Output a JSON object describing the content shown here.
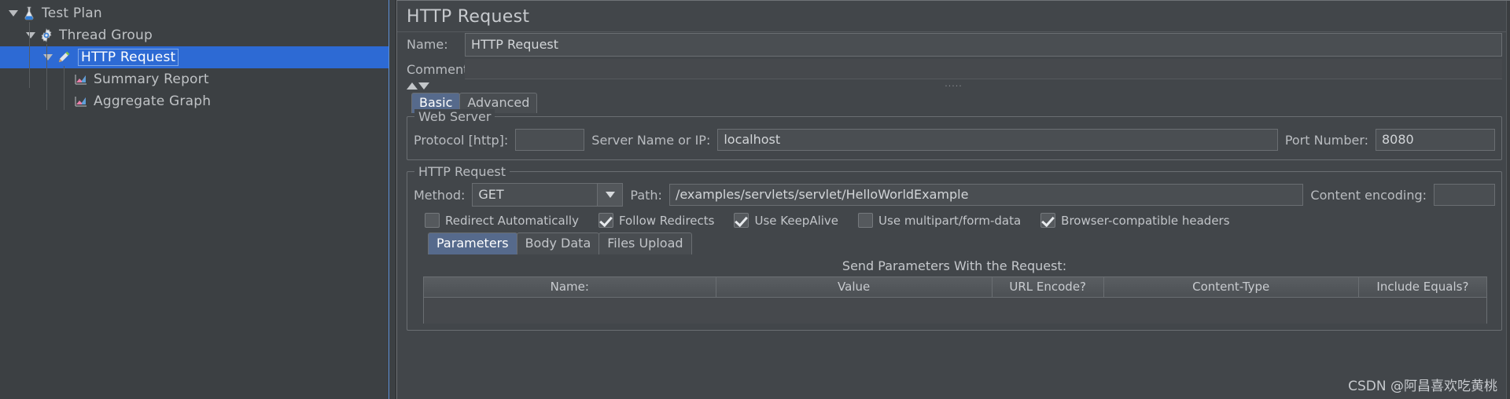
{
  "tree": {
    "items": [
      {
        "label": "Test Plan",
        "icon": "flask-icon",
        "indent": 1,
        "expanded": true,
        "selected": false
      },
      {
        "label": "Thread Group",
        "icon": "gear-icon",
        "indent": 2,
        "expanded": true,
        "selected": false
      },
      {
        "label": "HTTP Request",
        "icon": "pencil-icon",
        "indent": 3,
        "expanded": true,
        "selected": true
      },
      {
        "label": "Summary Report",
        "icon": "chart-icon",
        "indent": 4,
        "expanded": false,
        "selected": false
      },
      {
        "label": "Aggregate Graph",
        "icon": "chart-icon",
        "indent": 4,
        "expanded": false,
        "selected": false
      }
    ]
  },
  "detail": {
    "title": "HTTP Request",
    "name_label": "Name:",
    "name_value": "HTTP Request",
    "comments_label": "Comments:",
    "comments_value": "",
    "collapse_up_icon": "triangle-up-icon",
    "collapse_down_icon": "triangle-down-icon",
    "grip_glyph": "·····",
    "tabs": [
      {
        "label": "Basic",
        "active": true
      },
      {
        "label": "Advanced",
        "active": false
      }
    ],
    "web_server": {
      "group_label": "Web Server",
      "protocol_label": "Protocol [http]:",
      "protocol_value": "",
      "server_label": "Server Name or IP:",
      "server_value": "localhost",
      "port_label": "Port Number:",
      "port_value": "8080"
    },
    "http_request": {
      "group_label": "HTTP Request",
      "method_label": "Method:",
      "method_value": "GET",
      "method_dropdown_icon": "chevron-down-icon",
      "path_label": "Path:",
      "path_value": "/examples/servlets/servlet/HelloWorldExample",
      "content_encoding_label": "Content encoding:",
      "content_encoding_value": "",
      "checkboxes": [
        {
          "label": "Redirect Automatically",
          "checked": false
        },
        {
          "label": "Follow Redirects",
          "checked": true
        },
        {
          "label": "Use KeepAlive",
          "checked": true
        },
        {
          "label": "Use multipart/form-data",
          "checked": false
        },
        {
          "label": "Browser-compatible headers",
          "checked": true
        }
      ],
      "sub_tabs": [
        {
          "label": "Parameters",
          "active": true
        },
        {
          "label": "Body Data",
          "active": false
        },
        {
          "label": "Files Upload",
          "active": false
        }
      ],
      "send_params_title": "Send Parameters With the Request:",
      "table_headers": [
        "Name:",
        "Value",
        "URL Encode?",
        "Content-Type",
        "Include Equals?"
      ],
      "table_rows": []
    }
  },
  "watermark": "CSDN @阿昌喜欢吃黄桃",
  "colors": {
    "selection_blue": "#2d6ad4",
    "tab_active": "#566a8c",
    "panel_bg": "#42464a",
    "tree_bg": "#3c4043"
  }
}
